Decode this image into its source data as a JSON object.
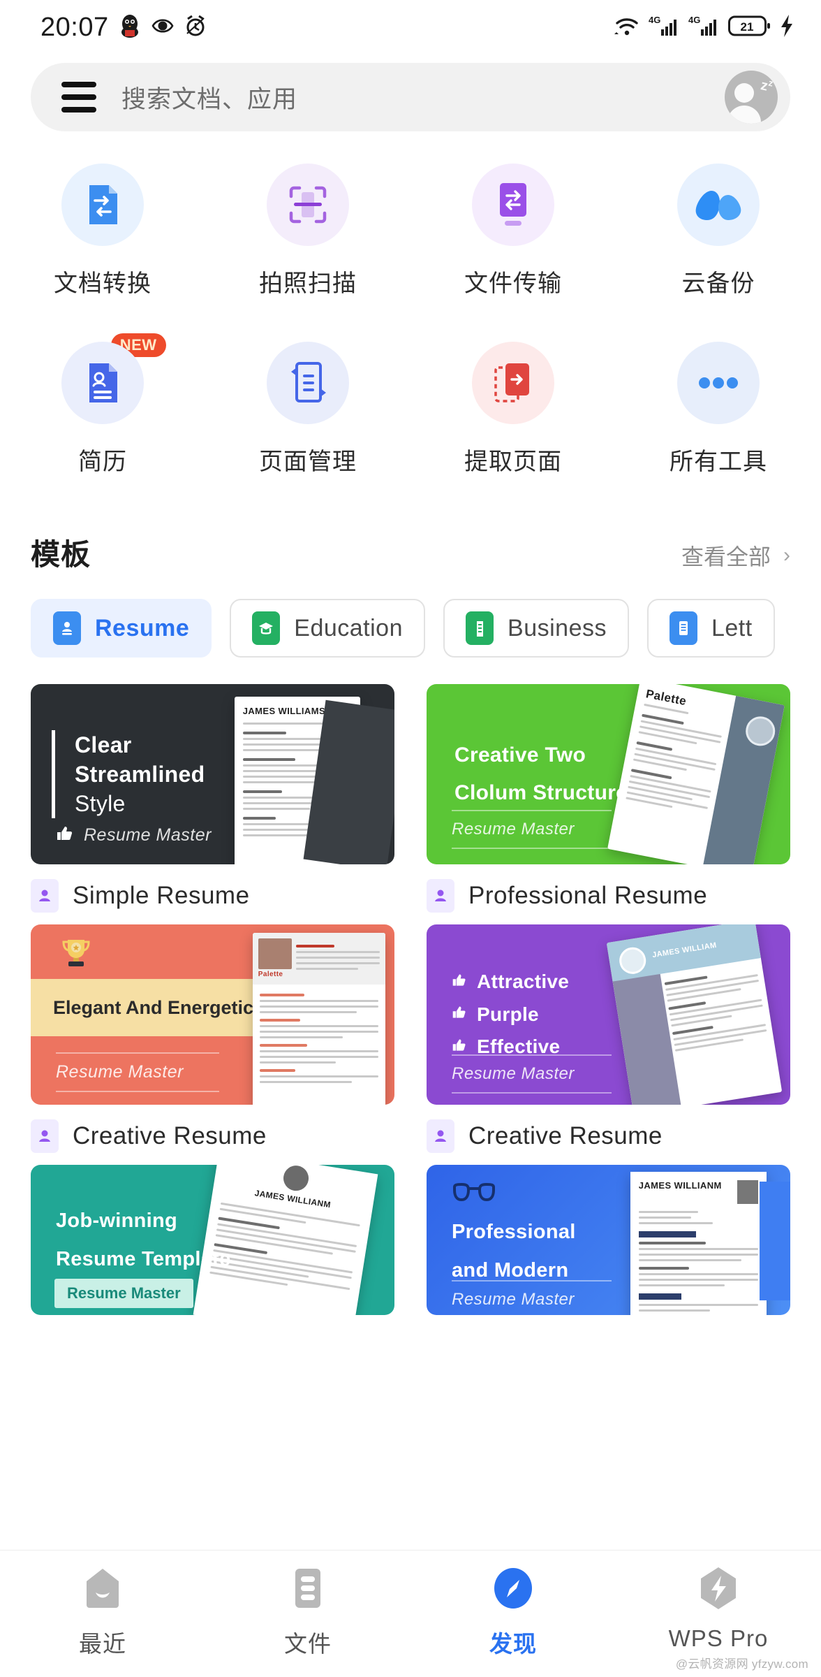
{
  "status_bar": {
    "time": "20:07",
    "left_icons": [
      "qq-penguin-icon",
      "eye-icon",
      "alarm-clock-icon"
    ],
    "right_icons": [
      "wifi-icon",
      "signal-4g-icon",
      "signal-4g-icon",
      "battery-icon",
      "charging-bolt-icon"
    ],
    "battery_level": "21",
    "network_label": "4G"
  },
  "search": {
    "placeholder": "搜索文档、应用",
    "menu_icon": "hamburger-menu-icon",
    "avatar_icon": "user-avatar-sleeping-icon"
  },
  "tools": {
    "rows": [
      [
        {
          "label": "文档转换",
          "icon": "document-convert-icon",
          "bg": "#e8f2fe",
          "fg": "#3c8ef0",
          "badge": ""
        },
        {
          "label": "拍照扫描",
          "icon": "camera-scan-icon",
          "bg": "#f4edfb",
          "fg": "#a463e0",
          "badge": ""
        },
        {
          "label": "文件传输",
          "icon": "file-transfer-icon",
          "bg": "#f5ecfd",
          "fg": "#9a4fe8",
          "badge": ""
        },
        {
          "label": "云备份",
          "icon": "cloud-backup-icon",
          "bg": "#e7f1fe",
          "fg": "#2e8ef5",
          "badge": ""
        }
      ],
      [
        {
          "label": "简历",
          "icon": "resume-icon",
          "bg": "#eaeefc",
          "fg": "#4566e8",
          "badge": "NEW"
        },
        {
          "label": "页面管理",
          "icon": "page-manage-icon",
          "bg": "#e9edfb",
          "fg": "#4566e8",
          "badge": ""
        },
        {
          "label": "提取页面",
          "icon": "extract-page-icon",
          "bg": "#fdeaea",
          "fg": "#e0453f",
          "badge": ""
        },
        {
          "label": "所有工具",
          "icon": "more-dots-icon",
          "bg": "#e7eefb",
          "fg": "#3c8ef0",
          "badge": ""
        }
      ]
    ]
  },
  "templates": {
    "section_title": "模板",
    "view_all": "查看全部",
    "view_all_icon": "chevron-right-icon",
    "tabs": [
      {
        "label": "Resume",
        "icon": "resume-card-icon",
        "color": "#3c8ef0",
        "active": true
      },
      {
        "label": "Education",
        "icon": "graduation-cap-icon",
        "color": "#24b062",
        "active": false
      },
      {
        "label": "Business",
        "icon": "office-building-icon",
        "color": "#24b062",
        "active": false
      },
      {
        "label": "Lett",
        "icon": "letter-doc-icon",
        "color": "#3c8ef0",
        "active": false
      }
    ],
    "cards": [
      {
        "title_lines": [
          "Clear",
          "Streamlined",
          "Style"
        ],
        "brand": "Resume Master",
        "brand_icon": "thumbs-up-icon",
        "caption": "Simple Resume",
        "caption_icon": "person-badge-icon",
        "bg": "#2b2f33",
        "paper_name": "JAMES WILLIAMS",
        "style": "dark-bar"
      },
      {
        "title_lines": [
          "Creative Two",
          "Clolum Structure"
        ],
        "brand": "Resume Master",
        "brand_icon": "",
        "caption": "Professional Resume",
        "caption_icon": "person-badge-icon",
        "bg": "#5bc636",
        "paper_name": "Palette",
        "style": "tilted-rules"
      },
      {
        "title_lines": [
          "Elegant And Energetic"
        ],
        "brand": "Resume Master",
        "brand_icon": "trophy-icon",
        "caption": "Creative Resume",
        "caption_icon": "person-badge-icon",
        "bg": "#ed7460",
        "paper_name": "Palette",
        "style": "banner-rules"
      },
      {
        "title_lines": [
          "Attractive",
          "Purple",
          "Effective"
        ],
        "brand": "Resume Master",
        "brand_icon": "thumbs-up-icon",
        "caption": "Creative Resume",
        "caption_icon": "person-badge-icon",
        "bg": "#8b4ad1",
        "paper_name": "JAMES WILLIAM",
        "style": "bullet-rules"
      },
      {
        "title_lines": [
          "Job-winning",
          "Resume Template"
        ],
        "brand": "Resume Master",
        "brand_icon": "",
        "caption": "",
        "caption_icon": "",
        "bg": "#21a795",
        "paper_name": "JAMES WILLIANM",
        "style": "tag-brand"
      },
      {
        "title_lines": [
          "Professional",
          "and Modern"
        ],
        "brand": "Resume Master",
        "brand_icon": "glasses-icon",
        "caption": "",
        "caption_icon": "",
        "bg": "#2f64e8",
        "paper_name": "JAMES WILLIANM",
        "style": "glasses-rules"
      }
    ]
  },
  "bottom_nav": {
    "items": [
      {
        "label": "最近",
        "icon": "recent-icon",
        "active": false
      },
      {
        "label": "文件",
        "icon": "files-icon",
        "active": false
      },
      {
        "label": "发现",
        "icon": "compass-discover-icon",
        "active": true
      },
      {
        "label": "WPS Pro",
        "icon": "lightning-pro-icon",
        "active": false
      }
    ],
    "active_color": "#2a72f0"
  },
  "watermark": "@云帆资源网 yfzyw.com"
}
